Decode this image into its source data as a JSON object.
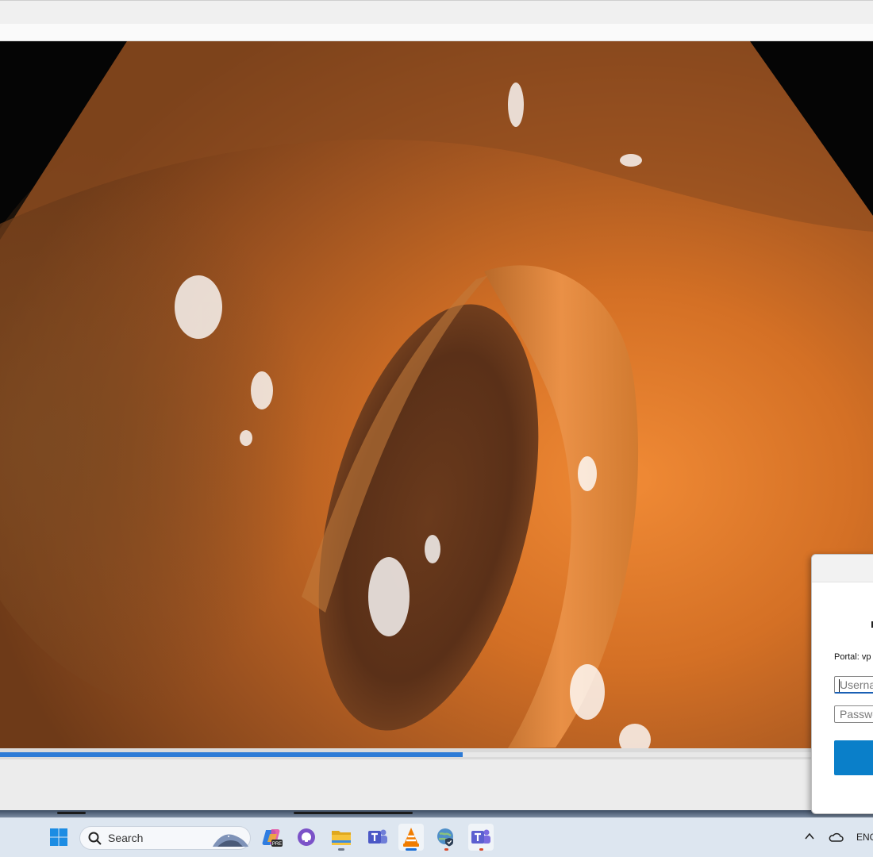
{
  "vpn_dialog": {
    "portal_label": "Portal: vp",
    "username_placeholder": "Userna",
    "password_placeholder": "Passwo"
  },
  "player": {
    "seek_progress_fraction": 0.53
  },
  "taskbar": {
    "search_label": "Search",
    "apps": [
      {
        "name": "start-icon"
      },
      {
        "name": "copilot-icon",
        "badge": "PRE"
      },
      {
        "name": "github-icon"
      },
      {
        "name": "file-explorer-icon"
      },
      {
        "name": "teams-icon"
      },
      {
        "name": "vlc-icon"
      },
      {
        "name": "globalprotect-icon"
      },
      {
        "name": "teams-new-icon"
      }
    ],
    "language": "ENG"
  },
  "colors": {
    "accent_blue": "#0a7fc9",
    "seek_fill": "#2d7bd6",
    "taskbar_bg": "#dde6f0"
  }
}
